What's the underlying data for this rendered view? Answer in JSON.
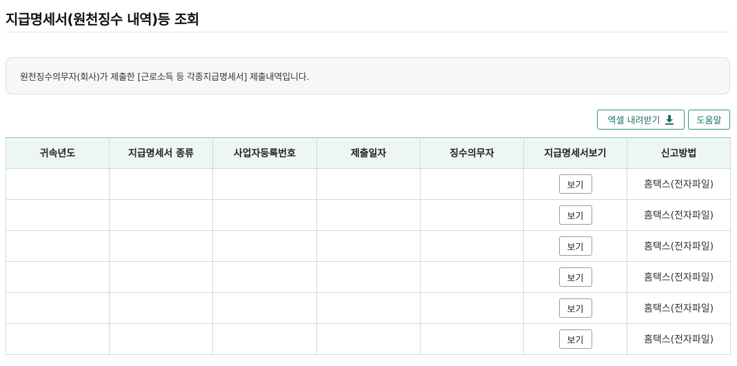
{
  "page": {
    "title": "지급명세서(원천징수 내역)등 조회",
    "notice": "원천징수의무자(회사)가 제출한 [근로소득 등 각종지급명세서] 제출내역입니다."
  },
  "toolbar": {
    "excel_label": "엑셀 내려받기",
    "excel_icon": "download-icon",
    "help_label": "도움말"
  },
  "table": {
    "headers": [
      "귀속년도",
      "지급명세서 종류",
      "사업자등록번호",
      "제출일자",
      "징수의무자",
      "지급명세서보기",
      "신고방법"
    ],
    "rows": [
      {
        "year": "",
        "type": "",
        "bizno": "",
        "date": "",
        "payer": "",
        "view_label": "보기",
        "method": "홈택스(전자파일)"
      },
      {
        "year": "",
        "type": "",
        "bizno": "",
        "date": "",
        "payer": "",
        "view_label": "보기",
        "method": "홈택스(전자파일)"
      },
      {
        "year": "",
        "type": "",
        "bizno": "",
        "date": "",
        "payer": "",
        "view_label": "보기",
        "method": "홈택스(전자파일)"
      },
      {
        "year": "",
        "type": "",
        "bizno": "",
        "date": "",
        "payer": "",
        "view_label": "보기",
        "method": "홈택스(전자파일)"
      },
      {
        "year": "",
        "type": "",
        "bizno": "",
        "date": "",
        "payer": "",
        "view_label": "보기",
        "method": "홈택스(전자파일)"
      },
      {
        "year": "",
        "type": "",
        "bizno": "",
        "date": "",
        "payer": "",
        "view_label": "보기",
        "method": "홈택스(전자파일)"
      }
    ]
  },
  "colors": {
    "accent": "#2f8f85",
    "header_bg": "#eef6f4",
    "border": "#c8dcd8"
  }
}
